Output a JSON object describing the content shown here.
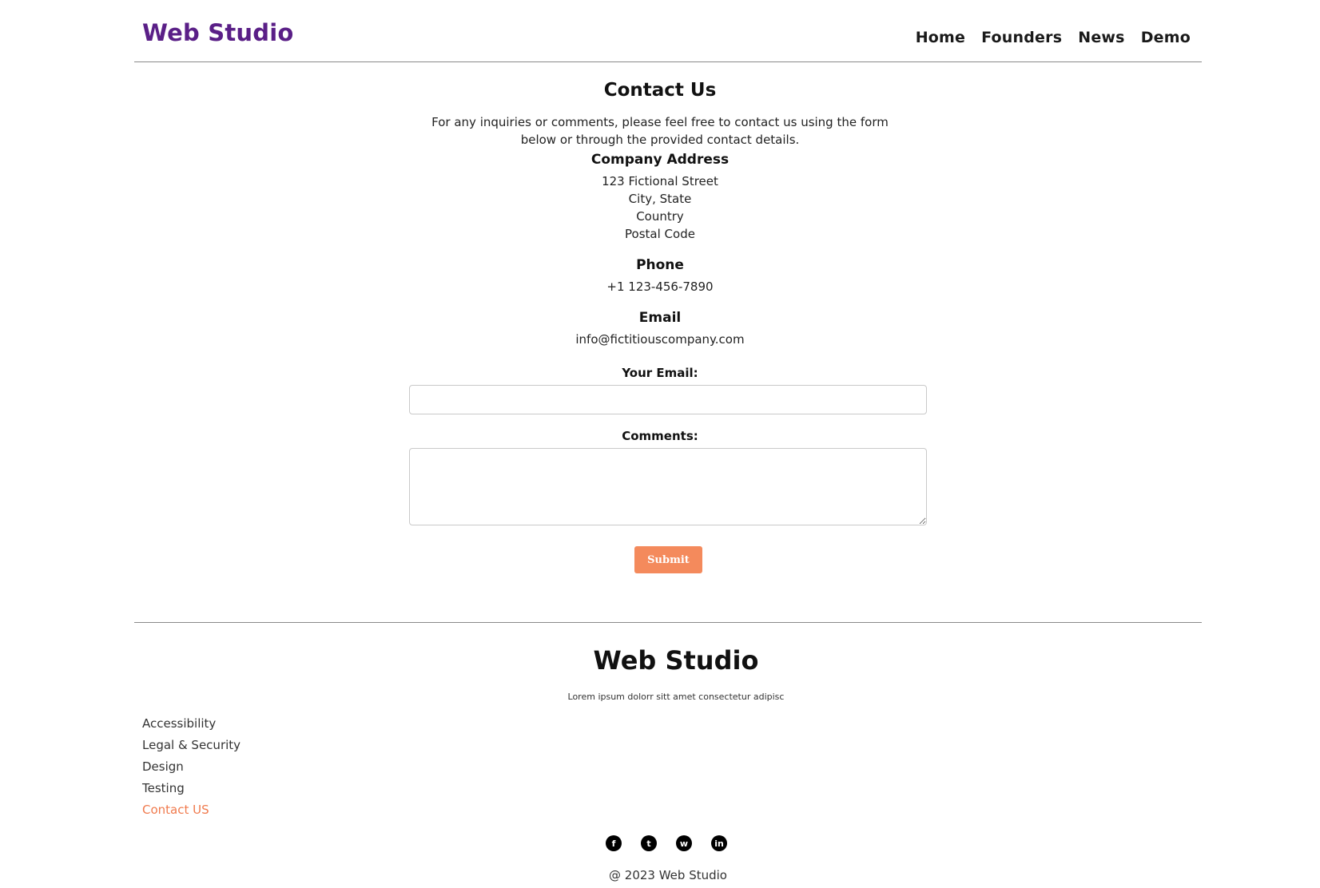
{
  "header": {
    "brand": "Web Studio",
    "nav": [
      "Home",
      "Founders",
      "News",
      "Demo"
    ]
  },
  "contact": {
    "title": "Contact Us",
    "intro": "For any inquiries or comments, please feel free to contact us using the form below or through the provided contact details.",
    "address_heading": "Company Address",
    "address_lines": [
      "123 Fictional Street",
      "City, State",
      "Country",
      "Postal Code"
    ],
    "phone_heading": "Phone",
    "phone": "+1 123-456-7890",
    "email_heading": "Email",
    "email": "info@fictitiouscompany.com"
  },
  "form": {
    "email_label": "Your Email:",
    "email_value": "",
    "comments_label": "Comments:",
    "comments_value": "",
    "submit_label": "Submit"
  },
  "footer": {
    "brand": "Web Studio",
    "tagline": "Lorem ipsum dolorr sitt amet consectetur adipisc",
    "links": [
      "Accessibility",
      "Legal & Security",
      "Design",
      "Testing",
      "Contact US"
    ],
    "socials": [
      {
        "name": "facebook-icon",
        "glyph": "f"
      },
      {
        "name": "twitter-icon",
        "glyph": "t"
      },
      {
        "name": "whatsapp-icon",
        "glyph": "w"
      },
      {
        "name": "linkedin-icon",
        "glyph": "in"
      }
    ],
    "copyright": "@ 2023 Web Studio"
  },
  "colors": {
    "brand": "#5a1f87",
    "accent": "#f48a5c",
    "link_highlight": "#f07a4d"
  }
}
